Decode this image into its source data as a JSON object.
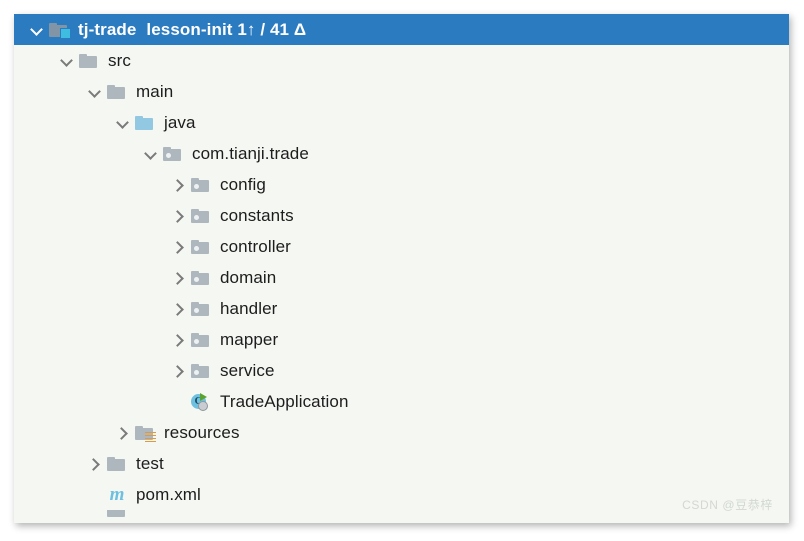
{
  "panel": {
    "background_color": "#f4f7f2",
    "selection_color": "#2b7bc0"
  },
  "tree": {
    "root": {
      "label": "tj-trade",
      "branch_info": "lesson-init 1↑ / 41 Δ",
      "icon": "module-folder-icon",
      "expanded": true,
      "selected": true
    },
    "items": [
      {
        "label": "src",
        "icon": "folder-icon",
        "depth": 1,
        "expanded": true,
        "has_toggle": true
      },
      {
        "label": "main",
        "icon": "folder-icon",
        "depth": 2,
        "expanded": true,
        "has_toggle": true
      },
      {
        "label": "java",
        "icon": "source-root-icon",
        "depth": 3,
        "expanded": true,
        "has_toggle": true
      },
      {
        "label": "com.tianji.trade",
        "icon": "package-icon",
        "depth": 4,
        "expanded": true,
        "has_toggle": true
      },
      {
        "label": "config",
        "icon": "package-icon",
        "depth": 5,
        "expanded": false,
        "has_toggle": true
      },
      {
        "label": "constants",
        "icon": "package-icon",
        "depth": 5,
        "expanded": false,
        "has_toggle": true
      },
      {
        "label": "controller",
        "icon": "package-icon",
        "depth": 5,
        "expanded": false,
        "has_toggle": true
      },
      {
        "label": "domain",
        "icon": "package-icon",
        "depth": 5,
        "expanded": false,
        "has_toggle": true
      },
      {
        "label": "handler",
        "icon": "package-icon",
        "depth": 5,
        "expanded": false,
        "has_toggle": true
      },
      {
        "label": "mapper",
        "icon": "package-icon",
        "depth": 5,
        "expanded": false,
        "has_toggle": true
      },
      {
        "label": "service",
        "icon": "package-icon",
        "depth": 5,
        "expanded": false,
        "has_toggle": true
      },
      {
        "label": "TradeApplication",
        "icon": "java-class-runnable-icon",
        "depth": 5,
        "expanded": false,
        "has_toggle": false
      },
      {
        "label": "resources",
        "icon": "resources-folder-icon",
        "depth": 3,
        "expanded": false,
        "has_toggle": true
      },
      {
        "label": "test",
        "icon": "folder-icon",
        "depth": 2,
        "expanded": false,
        "has_toggle": true
      },
      {
        "label": "pom.xml",
        "icon": "maven-file-icon",
        "depth": 1,
        "expanded": false,
        "has_toggle": false
      }
    ]
  },
  "watermark": {
    "text": "CSDN @豆恭梓"
  }
}
